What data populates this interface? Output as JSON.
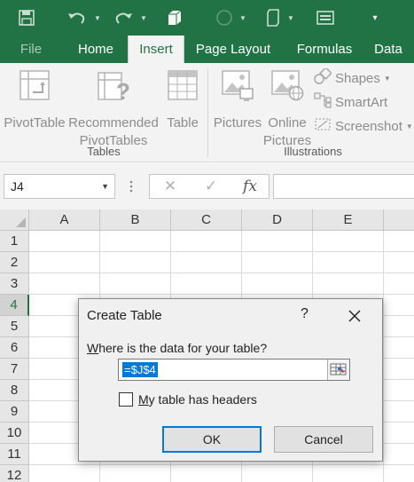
{
  "quick_access": {
    "icons": [
      "save-icon",
      "undo-icon",
      "redo-icon",
      "3d-box-icon",
      "circle-icon",
      "shape-icon",
      "screen-icon",
      "customize-icon"
    ]
  },
  "ribbon_tabs": [
    "File",
    "Home",
    "Insert",
    "Page Layout",
    "Formulas",
    "Data"
  ],
  "active_tab": "Insert",
  "ribbon": {
    "tables_group": {
      "label": "Tables",
      "pivottable": "PivotTable",
      "recommended_line1": "Recommended",
      "recommended_line2": "PivotTables",
      "table": "Table"
    },
    "illustrations_group": {
      "label": "Illustrations",
      "pictures": "Pictures",
      "online_line1": "Online",
      "online_line2": "Pictures",
      "shapes": "Shapes",
      "smartart": "SmartArt",
      "screenshot": "Screenshot"
    }
  },
  "formula_bar": {
    "name_box": "J4",
    "cancel_symbol": "✕",
    "enter_symbol": "✓",
    "fx_symbol": "fx",
    "value": ""
  },
  "sheet": {
    "columns": [
      "A",
      "B",
      "C",
      "D",
      "E"
    ],
    "rows": [
      "1",
      "2",
      "3",
      "4",
      "5",
      "6",
      "7",
      "8",
      "9",
      "10",
      "11",
      "12"
    ],
    "selected_row": "4"
  },
  "dialog": {
    "title": "Create Table",
    "help": "?",
    "question_prefix": "W",
    "question_rest": "here is the data for your table?",
    "range_value": "=$J$4",
    "checkbox_prefix": "M",
    "checkbox_rest": "y table has headers",
    "checkbox_checked": false,
    "ok_label": "OK",
    "cancel_label": "Cancel"
  },
  "colors": {
    "excel_green": "#217346",
    "selection_blue": "#0078d7"
  }
}
